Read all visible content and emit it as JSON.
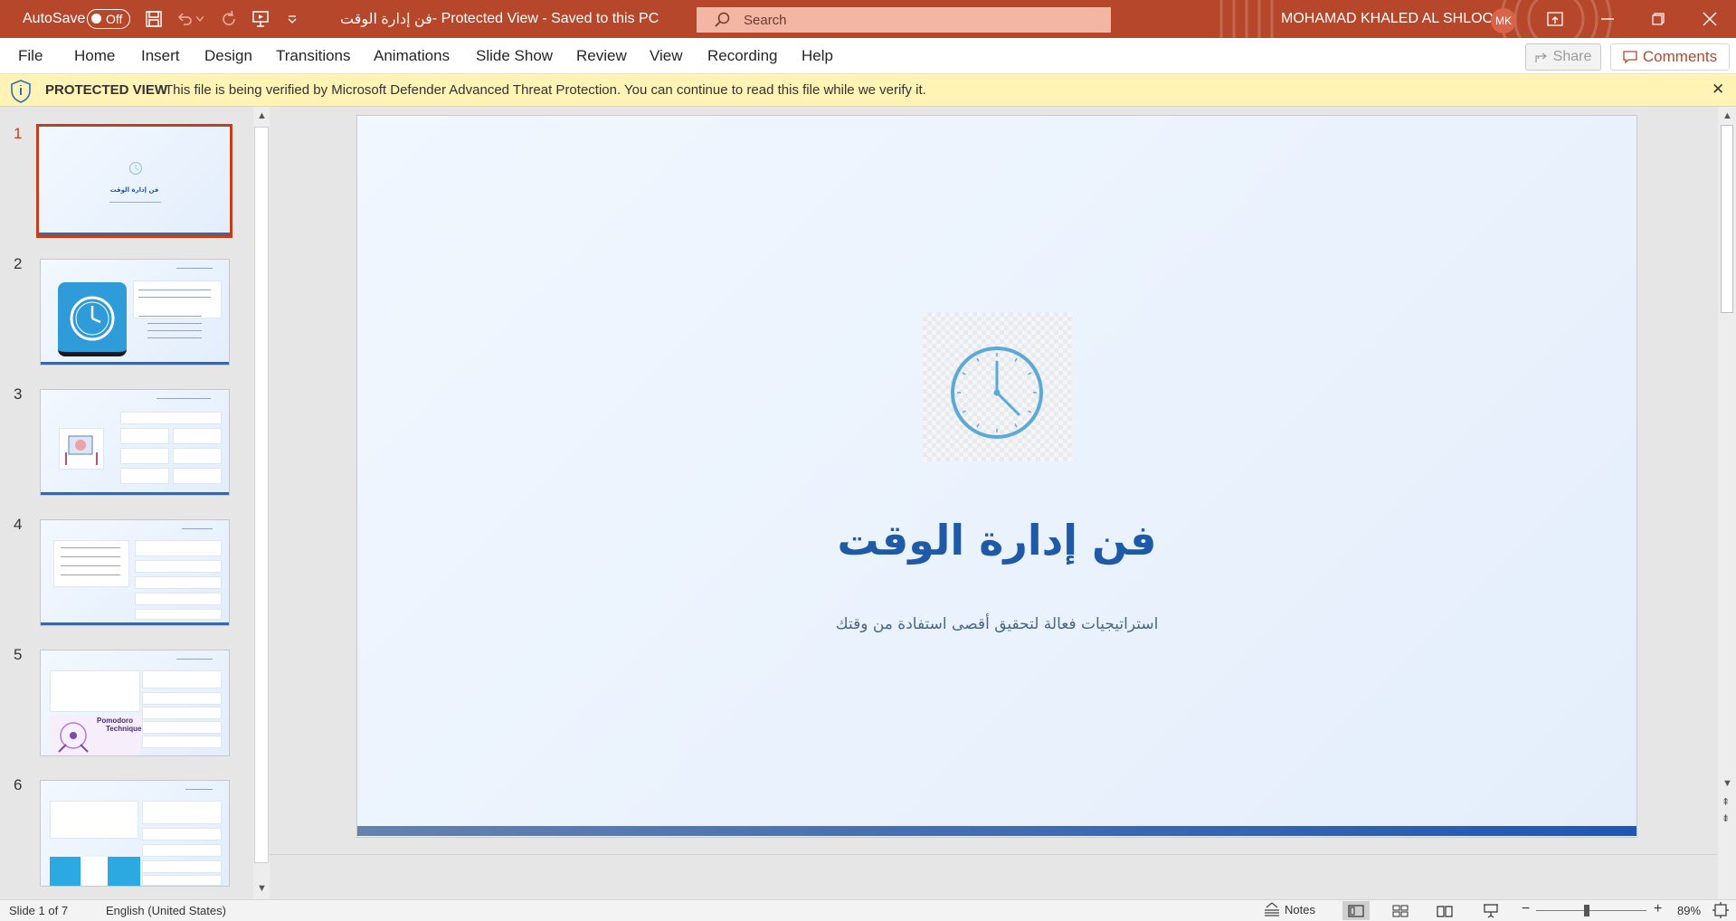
{
  "titlebar": {
    "autosave_label": "AutoSave",
    "autosave_state": "Off",
    "doc_title_rtl": "فن إدارة الوقت",
    "doc_title_suffix": " -  Protected View  -  Saved to this PC",
    "search_placeholder": "Search",
    "user_name": "MOHAMAD KHALED AL SHLOOL",
    "user_initials": "MK",
    "accent_color": "#b7472a"
  },
  "menu": {
    "items": [
      "File",
      "Home",
      "Insert",
      "Design",
      "Transitions",
      "Animations",
      "Slide Show",
      "Review",
      "View",
      "Recording",
      "Help"
    ],
    "share_label": "Share",
    "comments_label": "Comments"
  },
  "protected_view": {
    "title": "PROTECTED VIEW",
    "message": "This file is being verified by Microsoft Defender Advanced Threat Protection. You can continue to read this file while we verify it."
  },
  "thumbnails": {
    "numbers": [
      "1",
      "2",
      "3",
      "4",
      "5",
      "6"
    ],
    "active_index": 0,
    "slide1_title": "فن إدارة الوقت",
    "slide5_label_1": "Pomodoro",
    "slide5_label_2": "Technique"
  },
  "slide": {
    "title": "فن إدارة الوقت",
    "subtitle": "استراتيجيات فعالة لتحقيق أقصى استفادة من وقتك",
    "title_color": "#1e5aa8"
  },
  "status": {
    "slide_info": "Slide 1 of 7",
    "language": "English (United States)",
    "notes_label": "Notes",
    "zoom": "89%"
  }
}
